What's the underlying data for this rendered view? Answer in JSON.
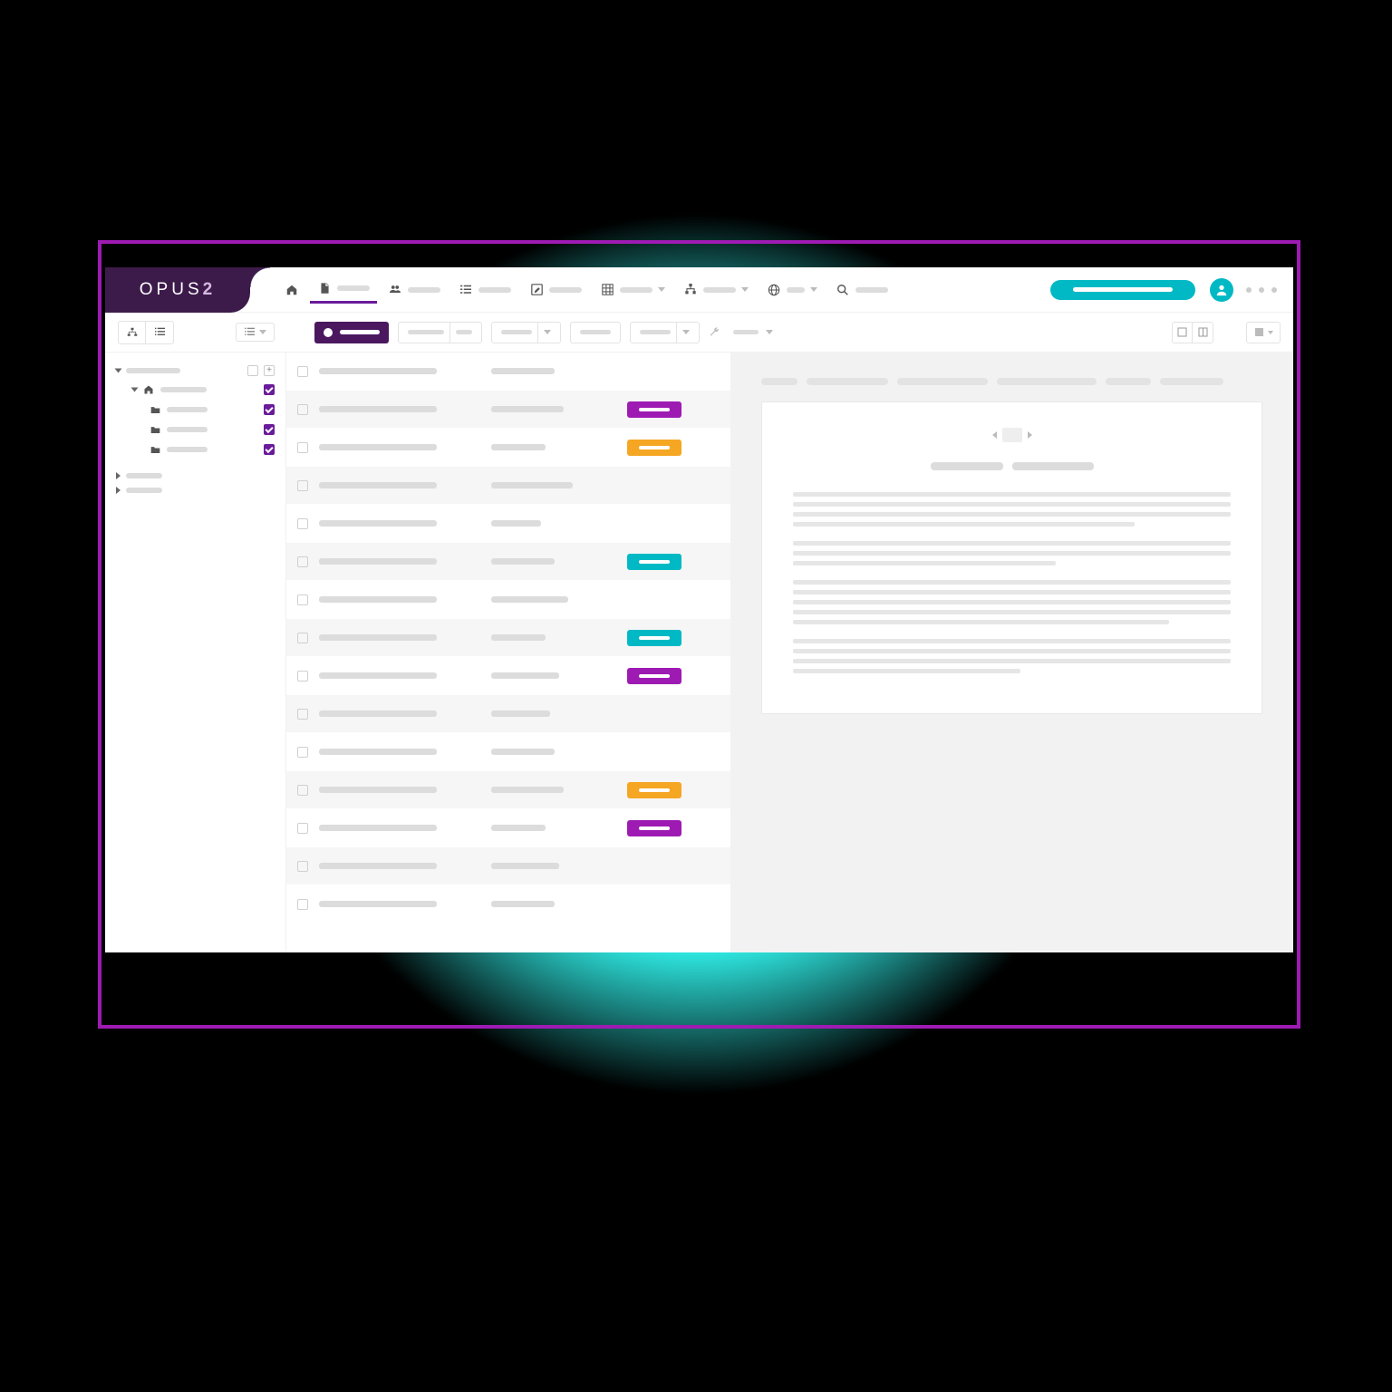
{
  "brand": {
    "name": "OPUS",
    "suffix": "2"
  },
  "colors": {
    "accent_purple": "#9e1bb3",
    "accent_teal": "#00b9c4",
    "accent_orange": "#f5a623",
    "brand_dark": "#3c1b4b",
    "glow": "#33fff8"
  },
  "topnav": {
    "items": [
      {
        "icon": "home-icon",
        "active": false
      },
      {
        "icon": "document-icon",
        "active": true
      },
      {
        "icon": "people-icon",
        "active": false
      },
      {
        "icon": "list-icon",
        "active": false
      },
      {
        "icon": "edit-icon",
        "active": false
      },
      {
        "icon": "grid-icon",
        "active": false,
        "dropdown": true
      },
      {
        "icon": "sitemap-icon",
        "active": false,
        "dropdown": true
      },
      {
        "icon": "globe-icon",
        "active": false,
        "dropdown": true
      },
      {
        "icon": "search-icon",
        "active": false
      }
    ]
  },
  "toolbar": {
    "primary_pill": true,
    "outline_pills": 4
  },
  "sidebar": {
    "nodes": [
      {
        "type": "root",
        "expanded": true,
        "controls": [
          "collapse",
          "add"
        ]
      },
      {
        "type": "home",
        "expanded": true,
        "checked": true
      },
      {
        "type": "folder",
        "checked": true
      },
      {
        "type": "folder",
        "checked": true
      },
      {
        "type": "folder",
        "checked": true
      },
      {
        "type": "collapsed"
      },
      {
        "type": "collapsed"
      }
    ]
  },
  "table": {
    "rows": [
      {
        "shade": false,
        "c2w": 70,
        "tag": null
      },
      {
        "shade": true,
        "c2w": 80,
        "tag": "purple"
      },
      {
        "shade": false,
        "c2w": 60,
        "tag": "orange"
      },
      {
        "shade": true,
        "c2w": 90,
        "tag": null
      },
      {
        "shade": false,
        "c2w": 55,
        "tag": null
      },
      {
        "shade": true,
        "c2w": 70,
        "tag": "teal"
      },
      {
        "shade": false,
        "c2w": 85,
        "tag": null
      },
      {
        "shade": true,
        "c2w": 60,
        "tag": "teal"
      },
      {
        "shade": false,
        "c2w": 75,
        "tag": "purple"
      },
      {
        "shade": true,
        "c2w": 65,
        "tag": null
      },
      {
        "shade": false,
        "c2w": 70,
        "tag": null
      },
      {
        "shade": true,
        "c2w": 80,
        "tag": "orange"
      },
      {
        "shade": false,
        "c2w": 60,
        "tag": "purple"
      },
      {
        "shade": true,
        "c2w": 75,
        "tag": null
      },
      {
        "shade": false,
        "c2w": 70,
        "tag": null
      }
    ]
  },
  "preview": {
    "tab_widths": [
      40,
      90,
      100,
      110,
      50,
      70
    ],
    "title_widths": [
      80,
      90
    ],
    "paragraphs": [
      {
        "lines": [
          100,
          100,
          100,
          78
        ]
      },
      {
        "lines": [
          100,
          100,
          60
        ]
      },
      {
        "lines": [
          100,
          100,
          100,
          100,
          86
        ]
      },
      {
        "lines": [
          100,
          100,
          100,
          52
        ]
      }
    ]
  }
}
